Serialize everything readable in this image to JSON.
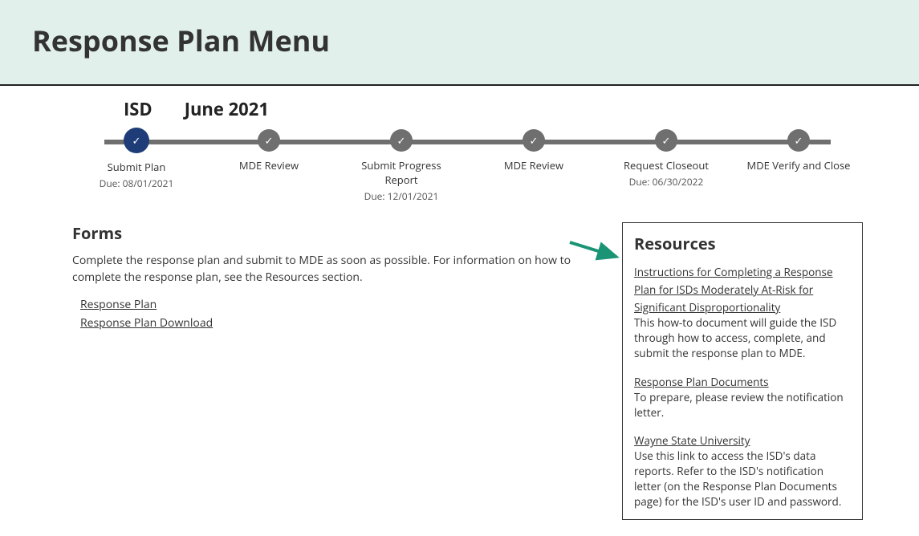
{
  "page_title": "Response Plan Menu",
  "stepper_header": {
    "isd": "ISD",
    "period": "June 2021"
  },
  "steps": [
    {
      "label": "Submit Plan",
      "due": "Due: 08/01/2021",
      "active": true
    },
    {
      "label": "MDE Review",
      "due": "",
      "active": false
    },
    {
      "label": "Submit Progress Report",
      "due": "Due: 12/01/2021",
      "active": false
    },
    {
      "label": "MDE Review",
      "due": "",
      "active": false
    },
    {
      "label": "Request Closeout",
      "due": "Due: 06/30/2022",
      "active": false
    },
    {
      "label": "MDE Verify and Close",
      "due": "",
      "active": false
    }
  ],
  "forms": {
    "title": "Forms",
    "desc": "Complete the response plan and submit to MDE as soon as possible. For information on how to complete the response plan, see the Resources section.",
    "links": {
      "response_plan": "Response Plan",
      "response_plan_download": "Response Plan Download"
    }
  },
  "resources": {
    "title": "Resources",
    "item1_link": "Instructions for Completing a Response Plan for ISDs Moderately At-Risk for Significant Disproportionality",
    "item1_desc": "This how-to document will guide the ISD through how to access, complete, and submit the response plan to MDE.",
    "item2_link": "Response Plan Documents",
    "item2_desc": "To prepare, please review the notification letter.",
    "item3_link": "Wayne State University",
    "item3_desc": "Use this link to access the ISD's data reports. Refer to the ISD's notification letter (on the Response Plan Documents page) for the ISD's user ID and password."
  }
}
